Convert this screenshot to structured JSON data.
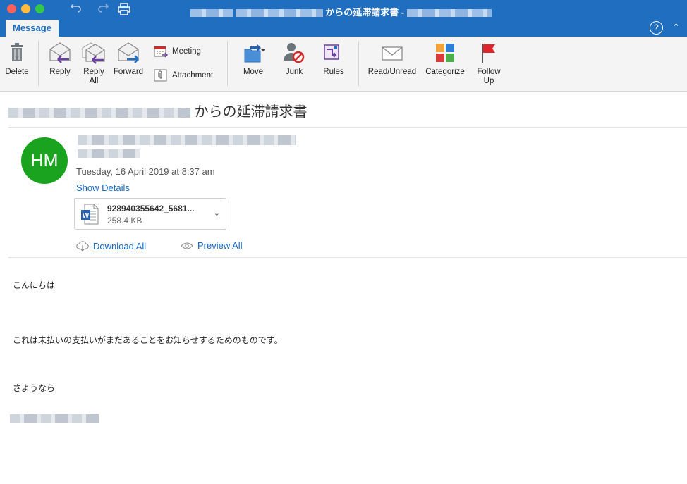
{
  "window": {
    "title_suffix": "からの延滞請求書 -"
  },
  "tabs": {
    "message": "Message"
  },
  "ribbon": {
    "delete": "Delete",
    "reply": "Reply",
    "reply_all_1": "Reply",
    "reply_all_2": "All",
    "forward": "Forward",
    "meeting": "Meeting",
    "attachment": "Attachment",
    "move": "Move",
    "junk": "Junk",
    "rules": "Rules",
    "read_unread": "Read/Unread",
    "categorize": "Categorize",
    "follow_up_1": "Follow",
    "follow_up_2": "Up",
    "help": "?"
  },
  "email": {
    "subject_suffix": "からの延滞請求書",
    "avatar_initials": "HM",
    "avatar_color": "#1aa31e",
    "date": "Tuesday, 16 April 2019 at 8:37 am",
    "show_details": "Show Details",
    "attachment_name": "928940355642_5681...",
    "attachment_size": "258.4 KB",
    "download_all": "Download All",
    "preview_all": "Preview All",
    "body_greeting": "こんにちは",
    "body_main": "これは未払いの支払いがまだあることをお知らせするためのものです。",
    "body_closing": "さようなら"
  },
  "colors": {
    "titlebar": "#1f6ec0",
    "link": "#1667c2",
    "flag": "#e0242b"
  }
}
